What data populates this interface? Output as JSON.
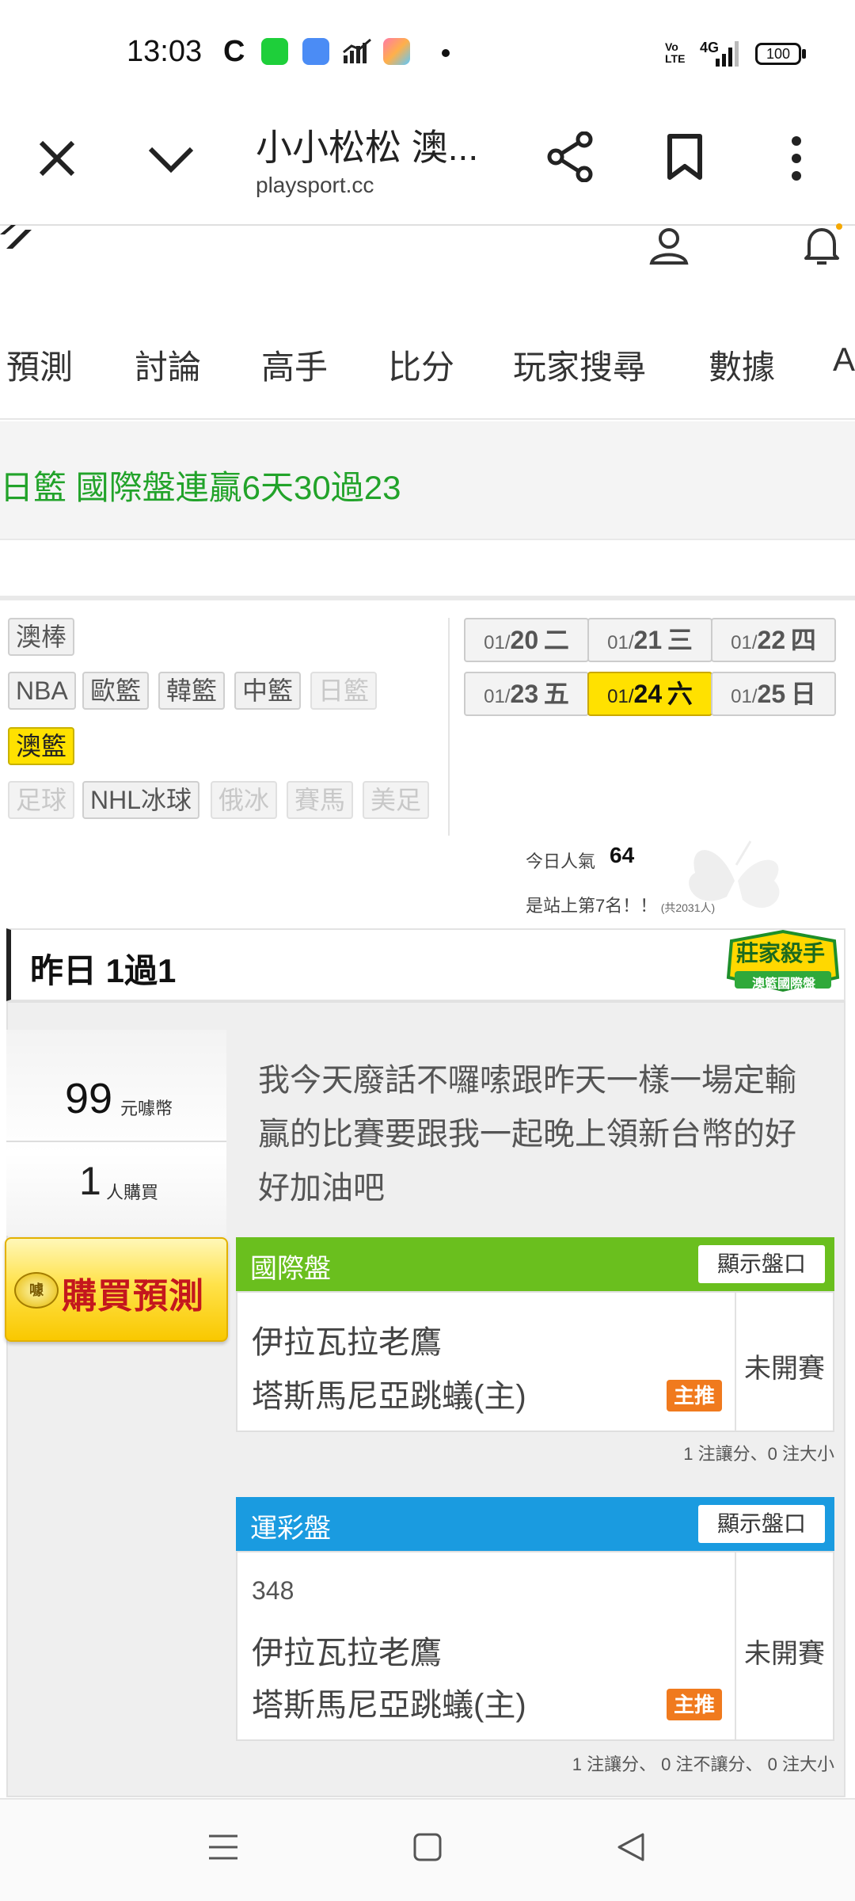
{
  "status_bar": {
    "time": "13:03",
    "c_icon": "C",
    "network": "4G",
    "volte": "Vo LTE",
    "battery": "100"
  },
  "browser": {
    "title": "小小松松 澳...",
    "url": "playsport.cc",
    "icons": [
      "close-icon",
      "chevron-down-icon",
      "share-icon",
      "bookmark-icon",
      "more-vert-icon"
    ]
  },
  "site_header": {
    "icons": [
      "logo-icon",
      "user-icon",
      "bell-icon"
    ]
  },
  "nav": {
    "items": [
      "預測",
      "討論",
      "高手",
      "比分",
      "玩家搜尋",
      "數據",
      "A"
    ]
  },
  "banner": {
    "text": "日籃 國際盤連贏6天30過23"
  },
  "league_tags": {
    "row1": [
      {
        "label": "澳棒",
        "state": "normal"
      }
    ],
    "row2": [
      {
        "label": "NBA",
        "state": "normal"
      },
      {
        "label": "歐籃",
        "state": "normal"
      },
      {
        "label": "韓籃",
        "state": "normal"
      },
      {
        "label": "中籃",
        "state": "normal"
      },
      {
        "label": "日籃",
        "state": "disabled"
      }
    ],
    "row3": [
      {
        "label": "澳籃",
        "state": "active"
      }
    ],
    "row4": [
      {
        "label": "足球",
        "state": "disabled"
      },
      {
        "label": "NHL冰球",
        "state": "normal"
      },
      {
        "label": "俄冰",
        "state": "disabled"
      },
      {
        "label": "賽馬",
        "state": "disabled"
      },
      {
        "label": "美足",
        "state": "disabled"
      }
    ]
  },
  "dates": [
    {
      "month": "01/",
      "day": "20",
      "weekday": "二",
      "active": false
    },
    {
      "month": "01/",
      "day": "21",
      "weekday": "三",
      "active": false
    },
    {
      "month": "01/",
      "day": "22",
      "weekday": "四",
      "active": false
    },
    {
      "month": "01/",
      "day": "23",
      "weekday": "五",
      "active": false
    },
    {
      "month": "01/",
      "day": "24",
      "weekday": "六",
      "active": true
    },
    {
      "month": "01/",
      "day": "25",
      "weekday": "日",
      "active": false
    }
  ],
  "popularity": {
    "label": "今日人氣",
    "value": "64",
    "rank_text": "是站上第7名！！",
    "total_text": "(共2031人)"
  },
  "section": {
    "title": "昨日 1過1",
    "badge_line1": "莊家殺手",
    "badge_line2": "澳籃國際盤"
  },
  "price": {
    "amount": "99",
    "unit": "元噱幣",
    "buyers": "1",
    "buyers_unit": "人購買",
    "buy_button": "購買預測",
    "coin_label": "噱"
  },
  "description": "我今天廢話不囉嗦跟昨天一樣一場定輸贏的比賽要跟我一起晚上領新台幣的好好加油吧",
  "markets": [
    {
      "title": "國際盤",
      "color": "#6abf1e",
      "show_button": "顯示盤口",
      "game_no": "",
      "away_team": "伊拉瓦拉老鷹",
      "home_team": "塔斯馬尼亞跳蟻(主)",
      "tag": "主推",
      "status": "未開賽",
      "note": "1 注讓分、0 注大小"
    },
    {
      "title": "運彩盤",
      "color": "#1a9be0",
      "show_button": "顯示盤口",
      "game_no": "348",
      "away_team": "伊拉瓦拉老鷹",
      "home_team": "塔斯馬尼亞跳蟻(主)",
      "tag": "主推",
      "status": "未開賽",
      "note": "1 注讓分、 0 注不讓分、 0 注大小"
    }
  ],
  "colors": {
    "banner_green": "#22a32a",
    "active_yellow": "#ffe100",
    "tag_orange": "#f07a1e"
  }
}
